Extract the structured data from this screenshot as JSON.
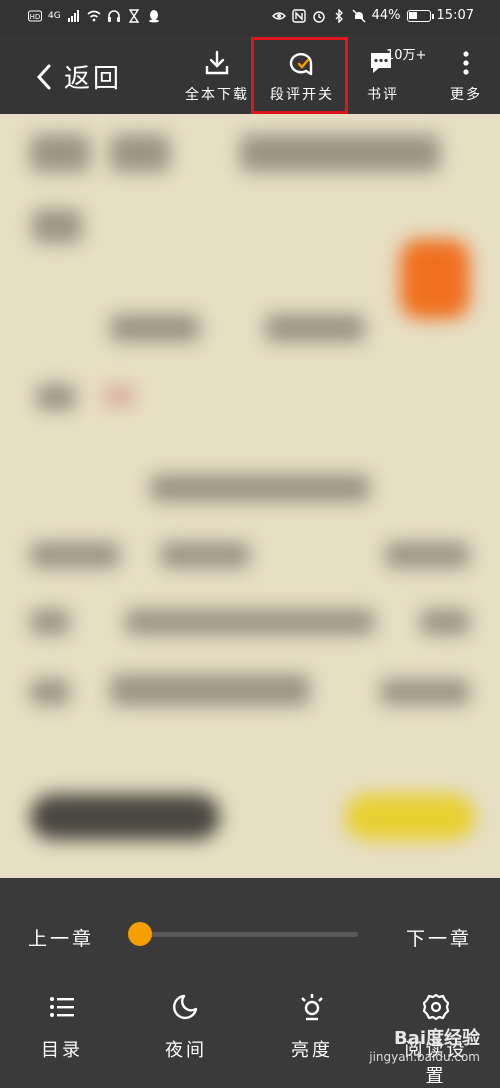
{
  "status_bar": {
    "network": "4G",
    "battery": "44%",
    "battery_level": 0.44,
    "time": "15:07",
    "icons_left": [
      "hd-icon",
      "signal-icon",
      "wifi-icon",
      "headphones-icon",
      "hourglass-icon",
      "qq-icon"
    ],
    "icons_right": [
      "eye-icon",
      "nfc-icon",
      "alarm-icon",
      "bluetooth-icon",
      "mute-icon"
    ]
  },
  "toolbar": {
    "back_label": "返回",
    "download_label": "全本下载",
    "comment_toggle_label": "段评开关",
    "review_label": "书评",
    "review_count": "10万+",
    "more_label": "更多"
  },
  "bottom": {
    "prev_chapter": "上一章",
    "next_chapter": "下一章",
    "progress": 0.0,
    "nav": [
      {
        "label": "目录",
        "icon": "list-icon"
      },
      {
        "label": "夜间",
        "icon": "moon-icon"
      },
      {
        "label": "亮度",
        "icon": "brightness-icon"
      },
      {
        "label": "阅读设置",
        "icon": "gear-icon"
      }
    ]
  },
  "watermark": {
    "text": "Bai度经验",
    "url": "jingyan.baidu.com"
  },
  "colors": {
    "accent": "#f5a000",
    "highlight": "#e0161d",
    "bar_bg": "#353535",
    "page_bg": "#e7dfc4"
  }
}
